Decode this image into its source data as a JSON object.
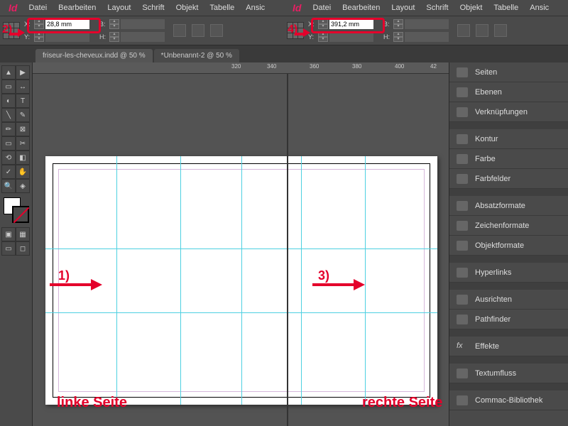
{
  "menu": [
    "Datei",
    "Bearbeiten",
    "Layout",
    "Schrift",
    "Objekt",
    "Tabelle",
    "Ansic"
  ],
  "logo": "Id",
  "coords": {
    "left": {
      "xLabel": "X:",
      "xValue": "28,8 mm",
      "yLabel": "Y:",
      "wLabel": "B:",
      "hLabel": "H:"
    },
    "right": {
      "xLabel": "X:",
      "xValue": "391,2 mm",
      "yLabel": "Y:",
      "wLabel": "B:",
      "hLabel": "H:"
    }
  },
  "tabs": [
    {
      "label": "friseur-les-cheveux.indd @ 50 %",
      "active": false
    },
    {
      "label": "*Unbenannt-2 @ 50 %",
      "active": true
    }
  ],
  "ruler": [
    "320",
    "340",
    "360",
    "380",
    "400",
    "42"
  ],
  "panels": [
    "Seiten",
    "Ebenen",
    "Verknüpfungen",
    "",
    "Kontur",
    "Farbe",
    "Farbfelder",
    "",
    "Absatzformate",
    "Zeichenformate",
    "Objektformate",
    "",
    "Hyperlinks",
    "",
    "Ausrichten",
    "Pathfinder",
    "",
    "Effekte",
    "",
    "Textumfluss",
    "",
    "Commac-Bibliothek"
  ],
  "annotations": {
    "n1": "1)",
    "n2": "2)",
    "n3": "3)",
    "n4": "4)",
    "leftLabel": "linke Seite",
    "rightLabel": "rechte Seite"
  }
}
